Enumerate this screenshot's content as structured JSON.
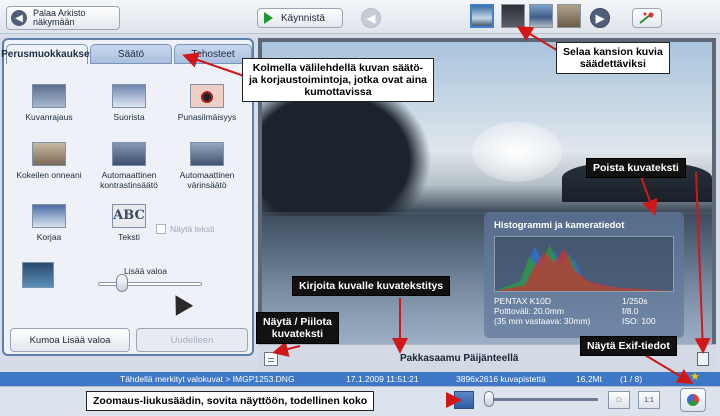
{
  "toolbar": {
    "back_label_1": "Palaa Arkisto",
    "back_label_2": "näkymään",
    "start_label": "Käynnistä"
  },
  "tabs": [
    "Perusmuokkaukset",
    "Säätö",
    "Tehosteet"
  ],
  "tools": {
    "crop": "Kuvanrajaus",
    "straighten": "Suorista",
    "redeye": "Punasilmäisyys",
    "lucky_1": "Kokeilen onneani",
    "contrast_1": "Automaattinen",
    "contrast_2": "kontrastinsäätö",
    "color_1": "Automaattinen",
    "color_2": "värinsäätö",
    "fix": "Korjaa",
    "text": "Teksti",
    "text_icon": "ABC",
    "show_text": "Näytä teksti",
    "fill_light": "Lisää valoa"
  },
  "buttons": {
    "undo": "Kumoa Lisää valoa",
    "redo": "Uudelleen",
    "fit": "",
    "actual": "1:1"
  },
  "histogram": {
    "title": "Histogrammi ja kameratiedot",
    "camera": "PENTAX K10D",
    "focal": "Polttoväli: 20.0mm",
    "equiv": "(35 mm vastaava:  30mm)",
    "shutter": "1/250s",
    "aperture": "f/8.0",
    "iso": "ISO: 100"
  },
  "caption": "Pakkasaamu Päijänteellä",
  "status": {
    "path": "Tähdellä merkityt valokuvat > IMGP1253.DNG",
    "date": "17.1.2009 11:51:21",
    "dims": "3896x2616 kuvapistettä",
    "size": "16,2Mt",
    "count": "(1 / 8)"
  },
  "fill_light_level": 0.2,
  "zoom_level": 0.0,
  "callouts": {
    "filmstrip": [
      "Selaa kansion kuvia",
      "säädettäviksi"
    ],
    "tabs": [
      "Kolmella välilehdellä kuvan säätö-",
      "ja korjaustoimintoja, jotka ovat aina",
      "kumottavissa"
    ],
    "delete_caption": "Poista kuvateksti",
    "write_caption": "Kirjoita kuvalle kuvatekstitys",
    "toggle_caption": [
      "Näytä / Piilota",
      "kuvateksti"
    ],
    "exif": "Näytä Exif-tiedot",
    "zoom": "Zoomaus-liukusäädin, sovita näyttöön, todellinen koko"
  },
  "colors": {
    "accent": "#3f78c6",
    "panel_border": "#5c7fae",
    "start_green": "#1f9a2e"
  },
  "icons": [
    "back-arrow-icon",
    "play-icon",
    "prev-arrow-icon",
    "next-arrow-icon",
    "fix-wand-icon",
    "caption-toggle-icon",
    "trash-icon",
    "star-icon",
    "zoom-icon",
    "exif-icon"
  ]
}
